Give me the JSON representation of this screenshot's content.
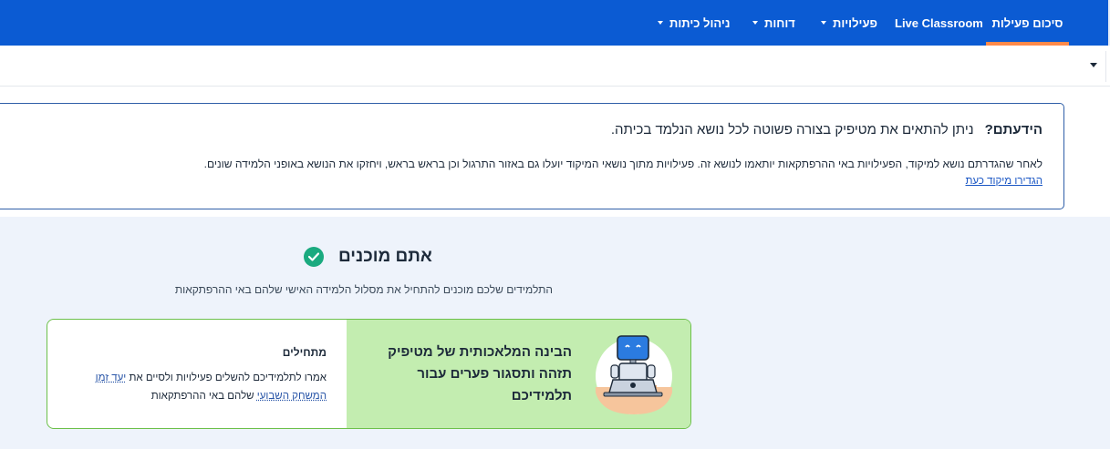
{
  "nav": {
    "items": [
      {
        "label": "סיכום פעילות",
        "active": true,
        "caret": false
      },
      {
        "label": "Live Classroom",
        "active": false,
        "caret": false
      },
      {
        "label": "פעילויות",
        "active": false,
        "caret": true
      },
      {
        "label": "דוחות",
        "active": false,
        "caret": true
      },
      {
        "label": "ניהול כיתות",
        "active": false,
        "caret": true
      }
    ]
  },
  "info": {
    "question": "הידעתם?",
    "headline": "ניתן להתאים את מטיפיק בצורה פשוטה לכל נושא הנלמד בכיתה.",
    "body": "לאחר שהגדרתם נושא למיקוד, הפעילויות באי ההרפתקאות יותאמו לנושא זה. פעילויות מתוך נושאי המיקוד יועלו גם באזור התרגול וכן בראש בראש, ויחזקו את הנושא באופני הלמידה שונים.",
    "link": "הגדירו מיקוד כעת"
  },
  "ready": {
    "title": "אתם מוכנים",
    "subtitle": "התלמידים שלכם מוכנים להתחיל את מסלול הלמידה האישי שלהם באי ההרפתקאות"
  },
  "card": {
    "promo_lines": [
      "הבינה המלאכותית של מטיפיק",
      "תזהה ותסגור פערים עבור",
      "תלמידיכם"
    ],
    "start_title": "מתחילים",
    "start_line1_text": "אמרו לתלמידיכם להשלים פעילויות ולסיים את ",
    "start_line1_link": "יעד זמן",
    "start_line2_link": "המשחק השבועי",
    "start_line2_text": " שלהם באי ההרפתקאות"
  },
  "colors": {
    "nav_bg": "#0b5bd3",
    "active_underline": "#ff8a4a",
    "success": "#1aaa7f",
    "promo_green": "#c3edb0",
    "link": "#1a56c4"
  }
}
